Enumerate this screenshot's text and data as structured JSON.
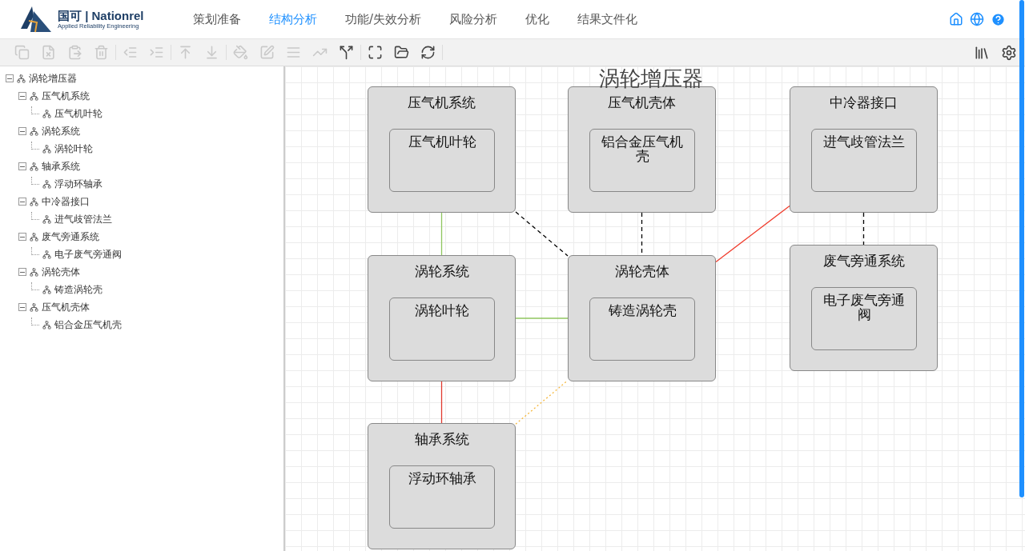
{
  "logo": {
    "brand": "国可 | Nationrel",
    "tagline": "Applied Reliability Engineering"
  },
  "nav": [
    {
      "label": "策划准备",
      "selected": false
    },
    {
      "label": "结构分析",
      "selected": true
    },
    {
      "label": "功能/失效分析",
      "selected": false
    },
    {
      "label": "风险分析",
      "selected": false
    },
    {
      "label": "优化",
      "selected": false
    },
    {
      "label": "结果文件化",
      "selected": false
    }
  ],
  "toolbar": [
    [
      {
        "disabled": true
      },
      {
        "disabled": true
      },
      {
        "disabled": true
      },
      {
        "disabled": true
      }
    ],
    [
      {
        "disabled": true
      },
      {
        "disabled": true
      }
    ],
    [
      {
        "disabled": true
      },
      {
        "disabled": true
      }
    ],
    [
      {
        "disabled": true
      },
      {
        "disabled": true
      },
      {
        "disabled": true
      },
      {
        "disabled": true
      },
      {
        "disabled": false
      }
    ],
    [
      {
        "disabled": false
      },
      {
        "disabled": false
      },
      {
        "disabled": false
      }
    ]
  ],
  "tree": [
    {
      "label": "涡轮增压器",
      "expanded": true,
      "children": [
        {
          "label": "压气机系统",
          "expanded": true,
          "children": [
            {
              "label": "压气机叶轮"
            }
          ]
        },
        {
          "label": "涡轮系统",
          "expanded": true,
          "children": [
            {
              "label": "涡轮叶轮"
            }
          ]
        },
        {
          "label": "轴承系统",
          "expanded": true,
          "children": [
            {
              "label": "浮动环轴承"
            }
          ]
        },
        {
          "label": "中冷器接口",
          "expanded": true,
          "children": [
            {
              "label": "进气歧管法兰"
            }
          ]
        },
        {
          "label": "废气旁通系统",
          "expanded": true,
          "children": [
            {
              "label": "电子废气旁通阀"
            }
          ]
        },
        {
          "label": "涡轮壳体",
          "expanded": true,
          "children": [
            {
              "label": "铸造涡轮壳"
            }
          ]
        },
        {
          "label": "压气机壳体",
          "expanded": true,
          "children": [
            {
              "label": "铝合金压气机壳"
            }
          ]
        }
      ]
    }
  ],
  "diagram": {
    "title": "涡轮增压器",
    "nodes": [
      {
        "title": "压气机系统",
        "children": [
          {
            "label": "压气机叶轮"
          }
        ]
      },
      {
        "title": "压气机壳体",
        "children": [
          {
            "label": "铝合金压气机壳"
          }
        ]
      },
      {
        "title": "中冷器接口",
        "children": [
          {
            "label": "进气歧管法兰"
          }
        ]
      },
      {
        "title": "涡轮系统",
        "children": [
          {
            "label": "涡轮叶轮"
          }
        ]
      },
      {
        "title": "涡轮壳体",
        "children": [
          {
            "label": "铸造涡轮壳"
          }
        ]
      },
      {
        "title": "废气旁通系统",
        "children": [
          {
            "label": "电子废气旁通阀"
          }
        ]
      },
      {
        "title": "轴承系统",
        "children": [
          {
            "label": "浮动环轴承"
          }
        ]
      }
    ],
    "edges": [
      {
        "kind": "solid",
        "color": "#8fc65f"
      },
      {
        "kind": "dashed",
        "color": "#000000"
      },
      {
        "kind": "dashed",
        "color": "#000000"
      },
      {
        "kind": "solid",
        "color": "#f03a2a"
      },
      {
        "kind": "dashed",
        "color": "#000000"
      },
      {
        "kind": "solid",
        "color": "#8fc65f"
      },
      {
        "kind": "solid",
        "color": "#e03a2e"
      },
      {
        "kind": "dotted",
        "color": "#f5b73b"
      }
    ]
  }
}
